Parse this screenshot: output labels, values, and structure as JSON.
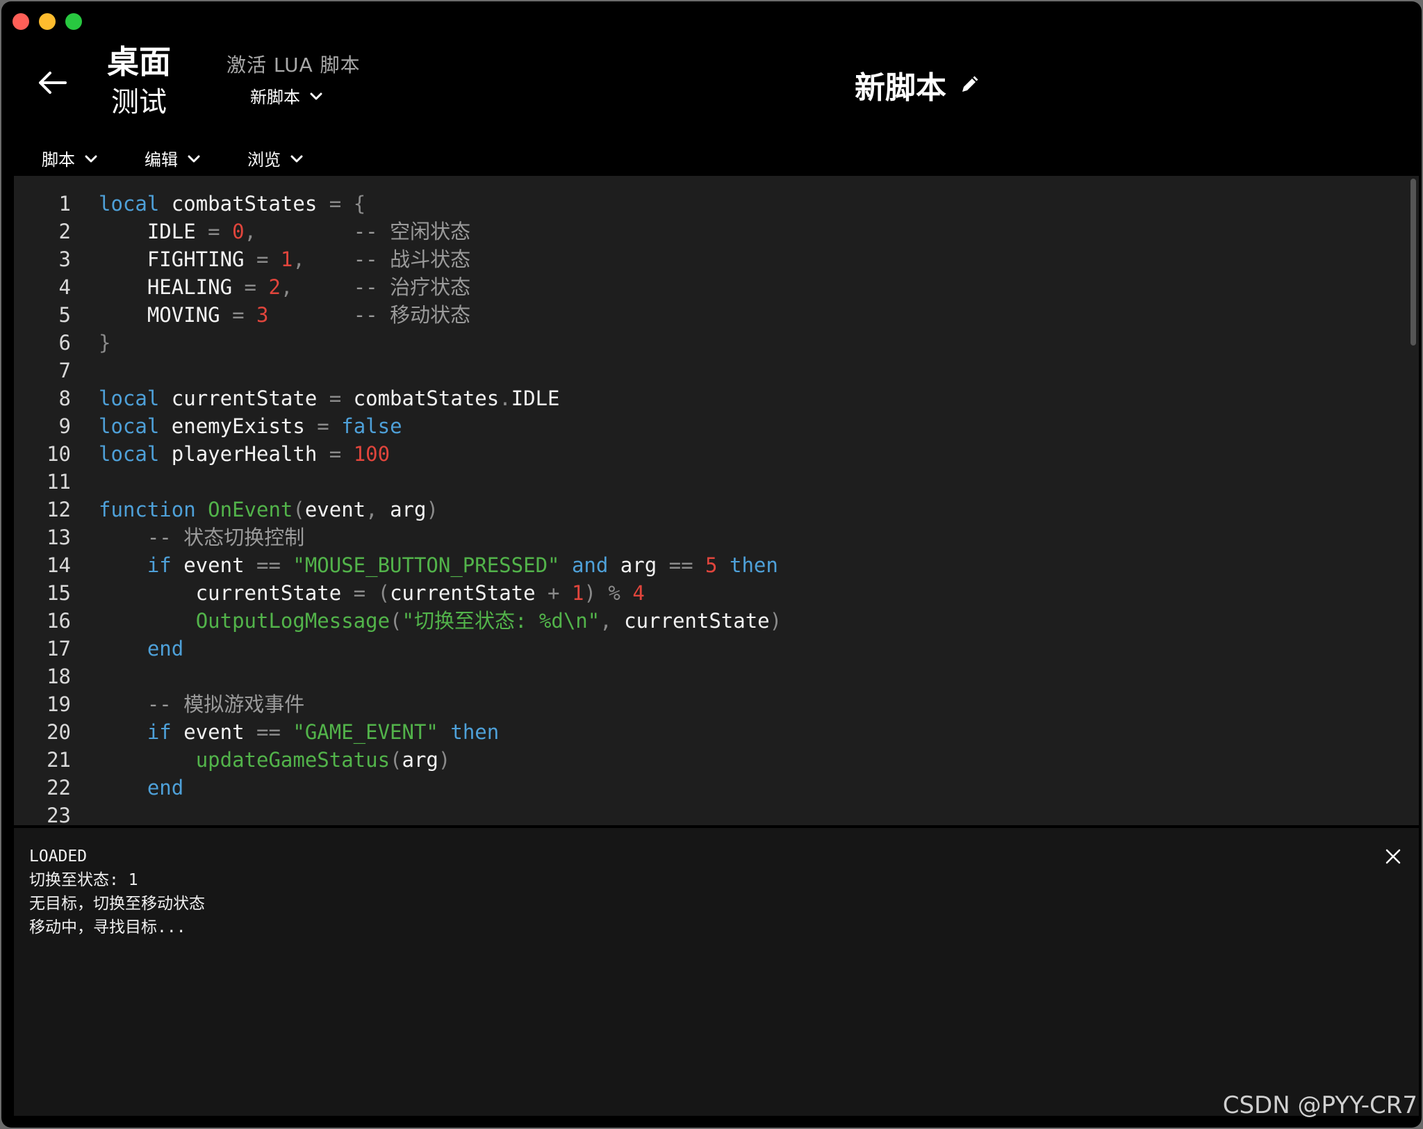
{
  "header": {
    "device_line1": "桌面",
    "device_line2": "测试",
    "activate_label": "激活 LUA 脚本",
    "selected_script": "新脚本",
    "title": "新脚本"
  },
  "menu": [
    {
      "label": "脚本"
    },
    {
      "label": "编辑"
    },
    {
      "label": "浏览"
    }
  ],
  "colors": {
    "keyword": "#4ea0d8",
    "function": "#52b34a",
    "string": "#52b34a",
    "number": "#e0453c",
    "comment": "#9a9a9a"
  },
  "code": [
    {
      "n": "1",
      "t": [
        [
          "kw",
          "local"
        ],
        [
          "pl",
          " combatStates "
        ],
        [
          "op",
          "="
        ],
        [
          "pl",
          " "
        ],
        [
          "op",
          "{"
        ]
      ]
    },
    {
      "n": "2",
      "t": [
        [
          "pl",
          "    IDLE "
        ],
        [
          "op",
          "="
        ],
        [
          "pl",
          " "
        ],
        [
          "num",
          "0"
        ],
        [
          "op",
          ","
        ],
        [
          "pl",
          "        "
        ],
        [
          "cm",
          "-- 空闲状态"
        ]
      ]
    },
    {
      "n": "3",
      "t": [
        [
          "pl",
          "    FIGHTING "
        ],
        [
          "op",
          "="
        ],
        [
          "pl",
          " "
        ],
        [
          "num",
          "1"
        ],
        [
          "op",
          ","
        ],
        [
          "pl",
          "    "
        ],
        [
          "cm",
          "-- 战斗状态"
        ]
      ]
    },
    {
      "n": "4",
      "t": [
        [
          "pl",
          "    HEALING "
        ],
        [
          "op",
          "="
        ],
        [
          "pl",
          " "
        ],
        [
          "num",
          "2"
        ],
        [
          "op",
          ","
        ],
        [
          "pl",
          "     "
        ],
        [
          "cm",
          "-- 治疗状态"
        ]
      ]
    },
    {
      "n": "5",
      "t": [
        [
          "pl",
          "    MOVING "
        ],
        [
          "op",
          "="
        ],
        [
          "pl",
          " "
        ],
        [
          "num",
          "3"
        ],
        [
          "pl",
          "       "
        ],
        [
          "cm",
          "-- 移动状态"
        ]
      ]
    },
    {
      "n": "6",
      "t": [
        [
          "op",
          "}"
        ]
      ]
    },
    {
      "n": "7",
      "t": []
    },
    {
      "n": "8",
      "t": [
        [
          "kw",
          "local"
        ],
        [
          "pl",
          " currentState "
        ],
        [
          "op",
          "="
        ],
        [
          "pl",
          " combatStates"
        ],
        [
          "op",
          "."
        ],
        [
          "pl",
          "IDLE"
        ]
      ]
    },
    {
      "n": "9",
      "t": [
        [
          "kw",
          "local"
        ],
        [
          "pl",
          " enemyExists "
        ],
        [
          "op",
          "="
        ],
        [
          "pl",
          " "
        ],
        [
          "kw",
          "false"
        ]
      ]
    },
    {
      "n": "10",
      "t": [
        [
          "kw",
          "local"
        ],
        [
          "pl",
          " playerHealth "
        ],
        [
          "op",
          "="
        ],
        [
          "pl",
          " "
        ],
        [
          "num",
          "100"
        ]
      ]
    },
    {
      "n": "11",
      "t": []
    },
    {
      "n": "12",
      "t": [
        [
          "kw",
          "function"
        ],
        [
          "pl",
          " "
        ],
        [
          "fn",
          "OnEvent"
        ],
        [
          "op",
          "("
        ],
        [
          "pl",
          "event"
        ],
        [
          "op",
          ","
        ],
        [
          "pl",
          " arg"
        ],
        [
          "op",
          ")"
        ]
      ]
    },
    {
      "n": "13",
      "t": [
        [
          "pl",
          "    "
        ],
        [
          "cm",
          "-- 状态切换控制"
        ]
      ]
    },
    {
      "n": "14",
      "t": [
        [
          "pl",
          "    "
        ],
        [
          "kw",
          "if"
        ],
        [
          "pl",
          " event "
        ],
        [
          "op",
          "=="
        ],
        [
          "pl",
          " "
        ],
        [
          "str",
          "\"MOUSE_BUTTON_PRESSED\""
        ],
        [
          "pl",
          " "
        ],
        [
          "kw",
          "and"
        ],
        [
          "pl",
          " arg "
        ],
        [
          "op",
          "=="
        ],
        [
          "pl",
          " "
        ],
        [
          "num",
          "5"
        ],
        [
          "pl",
          " "
        ],
        [
          "kw",
          "then"
        ]
      ]
    },
    {
      "n": "15",
      "t": [
        [
          "pl",
          "        currentState "
        ],
        [
          "op",
          "="
        ],
        [
          "pl",
          " "
        ],
        [
          "op",
          "("
        ],
        [
          "pl",
          "currentState "
        ],
        [
          "op",
          "+"
        ],
        [
          "pl",
          " "
        ],
        [
          "num",
          "1"
        ],
        [
          "op",
          ")"
        ],
        [
          "pl",
          " "
        ],
        [
          "op",
          "%"
        ],
        [
          "pl",
          " "
        ],
        [
          "num",
          "4"
        ]
      ]
    },
    {
      "n": "16",
      "t": [
        [
          "pl",
          "        "
        ],
        [
          "fn",
          "OutputLogMessage"
        ],
        [
          "op",
          "("
        ],
        [
          "str",
          "\"切换至状态: %d\\n\""
        ],
        [
          "op",
          ","
        ],
        [
          "pl",
          " currentState"
        ],
        [
          "op",
          ")"
        ]
      ]
    },
    {
      "n": "17",
      "t": [
        [
          "pl",
          "    "
        ],
        [
          "kw",
          "end"
        ]
      ]
    },
    {
      "n": "18",
      "t": []
    },
    {
      "n": "19",
      "t": [
        [
          "pl",
          "    "
        ],
        [
          "cm",
          "-- 模拟游戏事件"
        ]
      ]
    },
    {
      "n": "20",
      "t": [
        [
          "pl",
          "    "
        ],
        [
          "kw",
          "if"
        ],
        [
          "pl",
          " event "
        ],
        [
          "op",
          "=="
        ],
        [
          "pl",
          " "
        ],
        [
          "str",
          "\"GAME_EVENT\""
        ],
        [
          "pl",
          " "
        ],
        [
          "kw",
          "then"
        ]
      ]
    },
    {
      "n": "21",
      "t": [
        [
          "pl",
          "        "
        ],
        [
          "fn",
          "updateGameStatus"
        ],
        [
          "op",
          "("
        ],
        [
          "pl",
          "arg"
        ],
        [
          "op",
          ")"
        ]
      ]
    },
    {
      "n": "22",
      "t": [
        [
          "pl",
          "    "
        ],
        [
          "kw",
          "end"
        ]
      ]
    },
    {
      "n": "23",
      "t": []
    }
  ],
  "console": {
    "lines": [
      "LOADED",
      "切换至状态: 1",
      "无目标，切换至移动状态",
      "移动中，寻找目标..."
    ]
  },
  "watermark": "CSDN @PYY-CR7"
}
